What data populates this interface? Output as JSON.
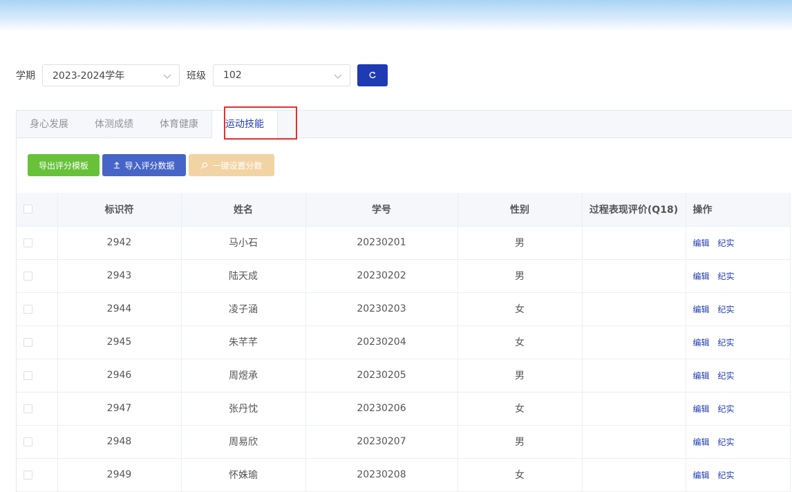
{
  "filters": {
    "term_label": "学期",
    "term_value": "2023-2024学年",
    "class_label": "班级",
    "class_value": "102"
  },
  "tabs": [
    {
      "label": "身心发展",
      "active": false
    },
    {
      "label": "体测成绩",
      "active": false
    },
    {
      "label": "体育健康",
      "active": false
    },
    {
      "label": "运动技能",
      "active": true
    }
  ],
  "actions": {
    "export_label": "导出评分模板",
    "import_label": "导入评分数据",
    "batch_label": "一键设置分数"
  },
  "table": {
    "headers": {
      "id": "标识符",
      "name": "姓名",
      "student_no": "学号",
      "gender": "性别",
      "process_eval": "过程表现评价(Q18)",
      "ops": "操作"
    },
    "edit_label": "编辑",
    "record_label": "纪实",
    "rows": [
      {
        "id": "2942",
        "name": "马小石",
        "student_no": "20230201",
        "gender": "男",
        "process_eval": ""
      },
      {
        "id": "2943",
        "name": "陆天成",
        "student_no": "20230202",
        "gender": "男",
        "process_eval": ""
      },
      {
        "id": "2944",
        "name": "凌子涵",
        "student_no": "20230203",
        "gender": "女",
        "process_eval": ""
      },
      {
        "id": "2945",
        "name": "朱芊芊",
        "student_no": "20230204",
        "gender": "女",
        "process_eval": ""
      },
      {
        "id": "2946",
        "name": "周煜承",
        "student_no": "20230205",
        "gender": "男",
        "process_eval": ""
      },
      {
        "id": "2947",
        "name": "张丹忱",
        "student_no": "20230206",
        "gender": "女",
        "process_eval": ""
      },
      {
        "id": "2948",
        "name": "周易欣",
        "student_no": "20230207",
        "gender": "男",
        "process_eval": ""
      },
      {
        "id": "2949",
        "name": "怀姝瑜",
        "student_no": "20230208",
        "gender": "女",
        "process_eval": ""
      }
    ]
  },
  "colors": {
    "primary": "#1f3bb3",
    "export_button": "#67c23a",
    "import_button": "#4765c7",
    "batch_button": "#f2d3a3",
    "highlight": "#e0302f"
  }
}
